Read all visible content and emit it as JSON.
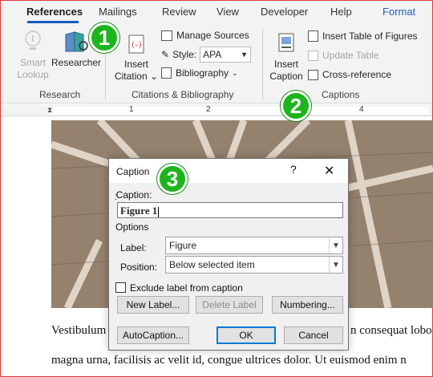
{
  "tabs": [
    {
      "label": "References"
    },
    {
      "label": "Mailings"
    },
    {
      "label": "Review"
    },
    {
      "label": "View"
    },
    {
      "label": "Developer"
    },
    {
      "label": "Help"
    },
    {
      "label": "Format"
    }
  ],
  "ribbon": {
    "research": {
      "smart_lookup": "Smart Lookup",
      "smart_lookup_line1": "Smart",
      "smart_lookup_line2": "Lookup",
      "researcher": "Researcher",
      "group_label": "Research"
    },
    "citations": {
      "insert_citation_line1": "Insert",
      "insert_citation_line2": "Citation",
      "manage_sources": "Manage Sources",
      "style_label": "Style:",
      "style_value": "APA",
      "bibliography": "Bibliography",
      "group_label": "Citations & Bibliography"
    },
    "captions": {
      "insert_caption_line1": "Insert",
      "insert_caption_line2": "Caption",
      "insert_table_of_figures": "Insert Table of Figures",
      "update_table": "Update Table",
      "cross_reference": "Cross-reference",
      "group_label": "Captions"
    }
  },
  "ruler": {
    "numbers": [
      "1",
      "2",
      "4"
    ]
  },
  "annotations": [
    "1",
    "2",
    "3"
  ],
  "document": {
    "line1_left": "Vestibulum",
    "line1_right": "n consequat lobo",
    "line2": "magna urna, facilisis ac velit id, congue ultrices dolor. Ut euismod enim n"
  },
  "dialog": {
    "title": "Caption",
    "help": "?",
    "close": "✕",
    "caption_label": "Caption:",
    "caption_value": "Figure 1",
    "options_label": "Options",
    "label_label": "Label:",
    "label_value": "Figure",
    "position_label": "Position:",
    "position_value": "Below selected item",
    "exclude_label": "Exclude label from caption",
    "exclude_checked": false,
    "new_label": "New Label...",
    "delete_label": "Delete Label",
    "numbering": "Numbering...",
    "autocaption": "AutoCaption...",
    "ok": "OK",
    "cancel": "Cancel"
  },
  "colors": {
    "accent": "#185abd",
    "badge": "#1db51d",
    "frame": "#e03a3a"
  }
}
